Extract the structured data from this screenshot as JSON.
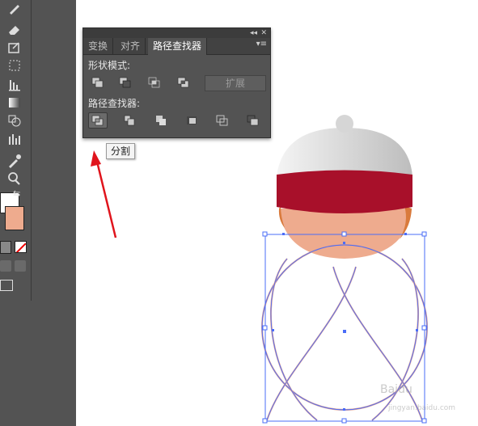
{
  "panel": {
    "tabs": [
      {
        "label": "变换",
        "active": false
      },
      {
        "label": "对齐",
        "active": false
      },
      {
        "label": "路径查找器",
        "active": true
      }
    ],
    "collapse_glyph": "◂◂",
    "close_glyph": "✕",
    "menu_glyph": "▾≡",
    "shape_modes_label": "形状模式:",
    "expand_label": "扩展",
    "pathfinders_label": "路径查找器:"
  },
  "tooltip": {
    "text": "分割"
  },
  "colors": {
    "hat_red": "#a8102a",
    "hat_gray": "#e8e8e8",
    "skin": "#eeab8e",
    "selection_blue": "#4a6cf7",
    "arrow_red": "#e0141c"
  },
  "watermark": {
    "line1": "Baidu",
    "line2": "jingyan.baidu.com"
  }
}
